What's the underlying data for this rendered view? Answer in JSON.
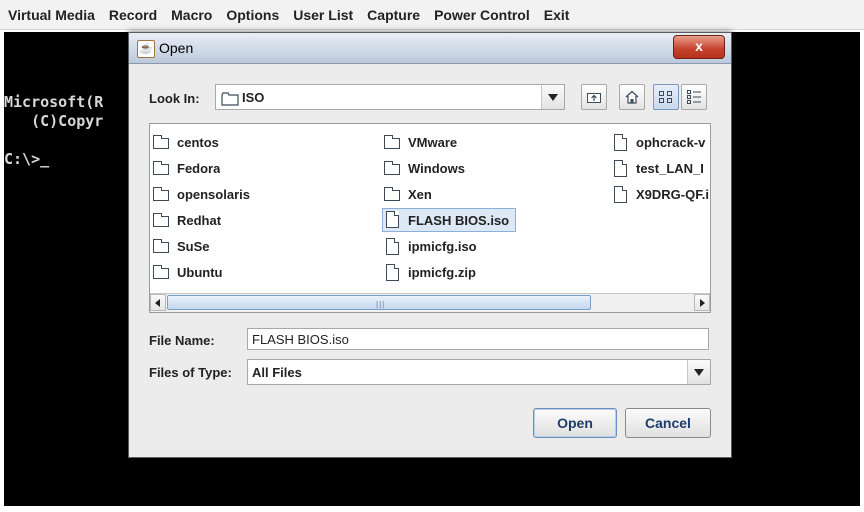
{
  "menubar": {
    "items": [
      "Virtual Media",
      "Record",
      "Macro",
      "Options",
      "User List",
      "Capture",
      "Power Control",
      "Exit"
    ]
  },
  "console": {
    "lines": [
      "Microsoft(R",
      "   (C)Copyr",
      "C:\\>_"
    ]
  },
  "dialog": {
    "title": "Open",
    "close_label": "x",
    "look_in_label": "Look In:",
    "look_in_value": "ISO",
    "files": [
      {
        "name": "centos",
        "kind": "folder"
      },
      {
        "name": "Fedora",
        "kind": "folder"
      },
      {
        "name": "opensolaris",
        "kind": "folder"
      },
      {
        "name": "Redhat",
        "kind": "folder"
      },
      {
        "name": "SuSe",
        "kind": "folder"
      },
      {
        "name": "Ubuntu",
        "kind": "folder"
      },
      {
        "name": "VMware",
        "kind": "folder"
      },
      {
        "name": "Windows",
        "kind": "folder"
      },
      {
        "name": "Xen",
        "kind": "folder"
      },
      {
        "name": "FLASH BIOS.iso",
        "kind": "file",
        "selected": true
      },
      {
        "name": "ipmicfg.iso",
        "kind": "file"
      },
      {
        "name": "ipmicfg.zip",
        "kind": "file"
      },
      {
        "name": "ophcrack-v",
        "kind": "file"
      },
      {
        "name": "test_LAN_I",
        "kind": "file"
      },
      {
        "name": "X9DRG-QF.i",
        "kind": "file"
      }
    ],
    "file_name_label": "File Name:",
    "file_name_value": "FLASH BIOS.iso",
    "files_of_type_label": "Files of Type:",
    "files_of_type_value": "All Files",
    "open_button": "Open",
    "cancel_button": "Cancel",
    "scrollbar_grip": "|||"
  },
  "icons": {
    "app": "java-icon",
    "up": "up-folder-icon",
    "home": "home-icon",
    "list": "list-view-icon",
    "details": "details-view-icon"
  }
}
